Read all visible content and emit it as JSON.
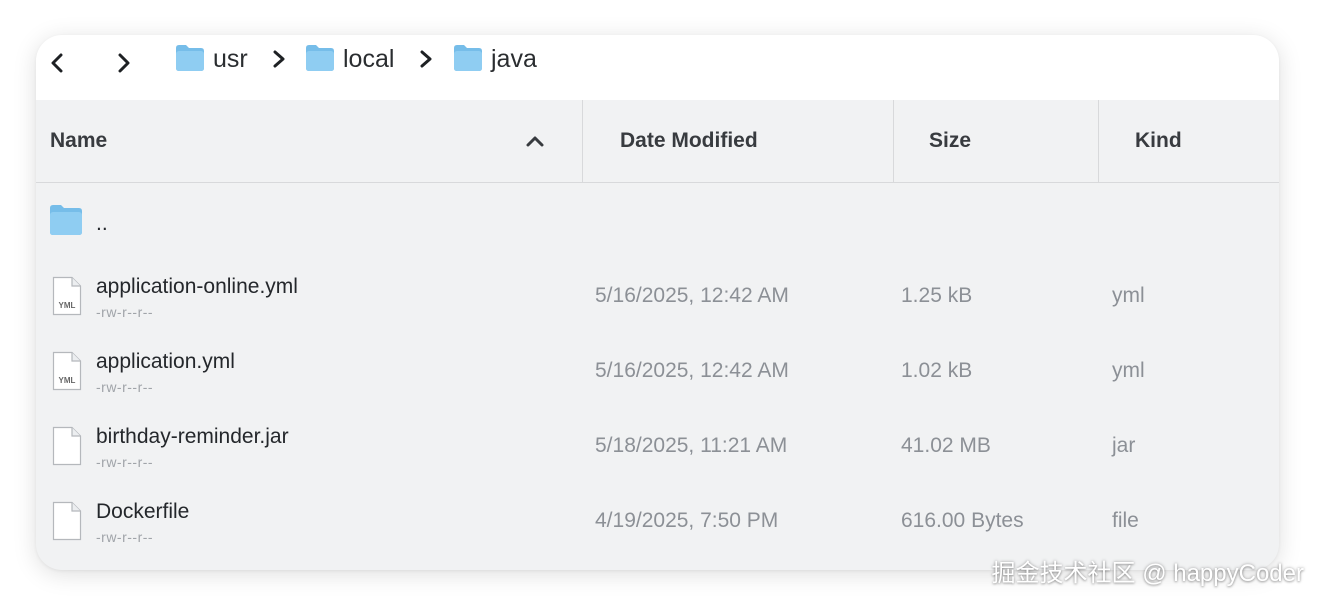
{
  "breadcrumb": [
    "usr",
    "local",
    "java"
  ],
  "columns": {
    "name": "Name",
    "date_modified": "Date Modified",
    "size": "Size",
    "kind": "Kind"
  },
  "parent_dir": {
    "label": ".."
  },
  "files": [
    {
      "name": "application-online.yml",
      "permissions": "-rw-r--r--",
      "date": "5/16/2025, 12:42 AM",
      "size": "1.25 kB",
      "kind": "yml",
      "icon": "yml-file-icon",
      "badge": "YML"
    },
    {
      "name": "application.yml",
      "permissions": "-rw-r--r--",
      "date": "5/16/2025, 12:42 AM",
      "size": "1.02 kB",
      "kind": "yml",
      "icon": "yml-file-icon",
      "badge": "YML"
    },
    {
      "name": "birthday-reminder.jar",
      "permissions": "-rw-r--r--",
      "date": "5/18/2025, 11:21 AM",
      "size": "41.02 MB",
      "kind": "jar",
      "icon": "generic-file-icon"
    },
    {
      "name": "Dockerfile",
      "permissions": "-rw-r--r--",
      "date": "4/19/2025, 7:50 PM",
      "size": "616.00 Bytes",
      "kind": "file",
      "icon": "generic-file-icon"
    }
  ],
  "watermark": "掘金技术社区 @ happyCoder",
  "colors": {
    "folder": "#8fcdf2",
    "folder_dark": "#76bde9",
    "window_bg": "#f1f2f3",
    "pathbar_bg": "#ffffff"
  }
}
